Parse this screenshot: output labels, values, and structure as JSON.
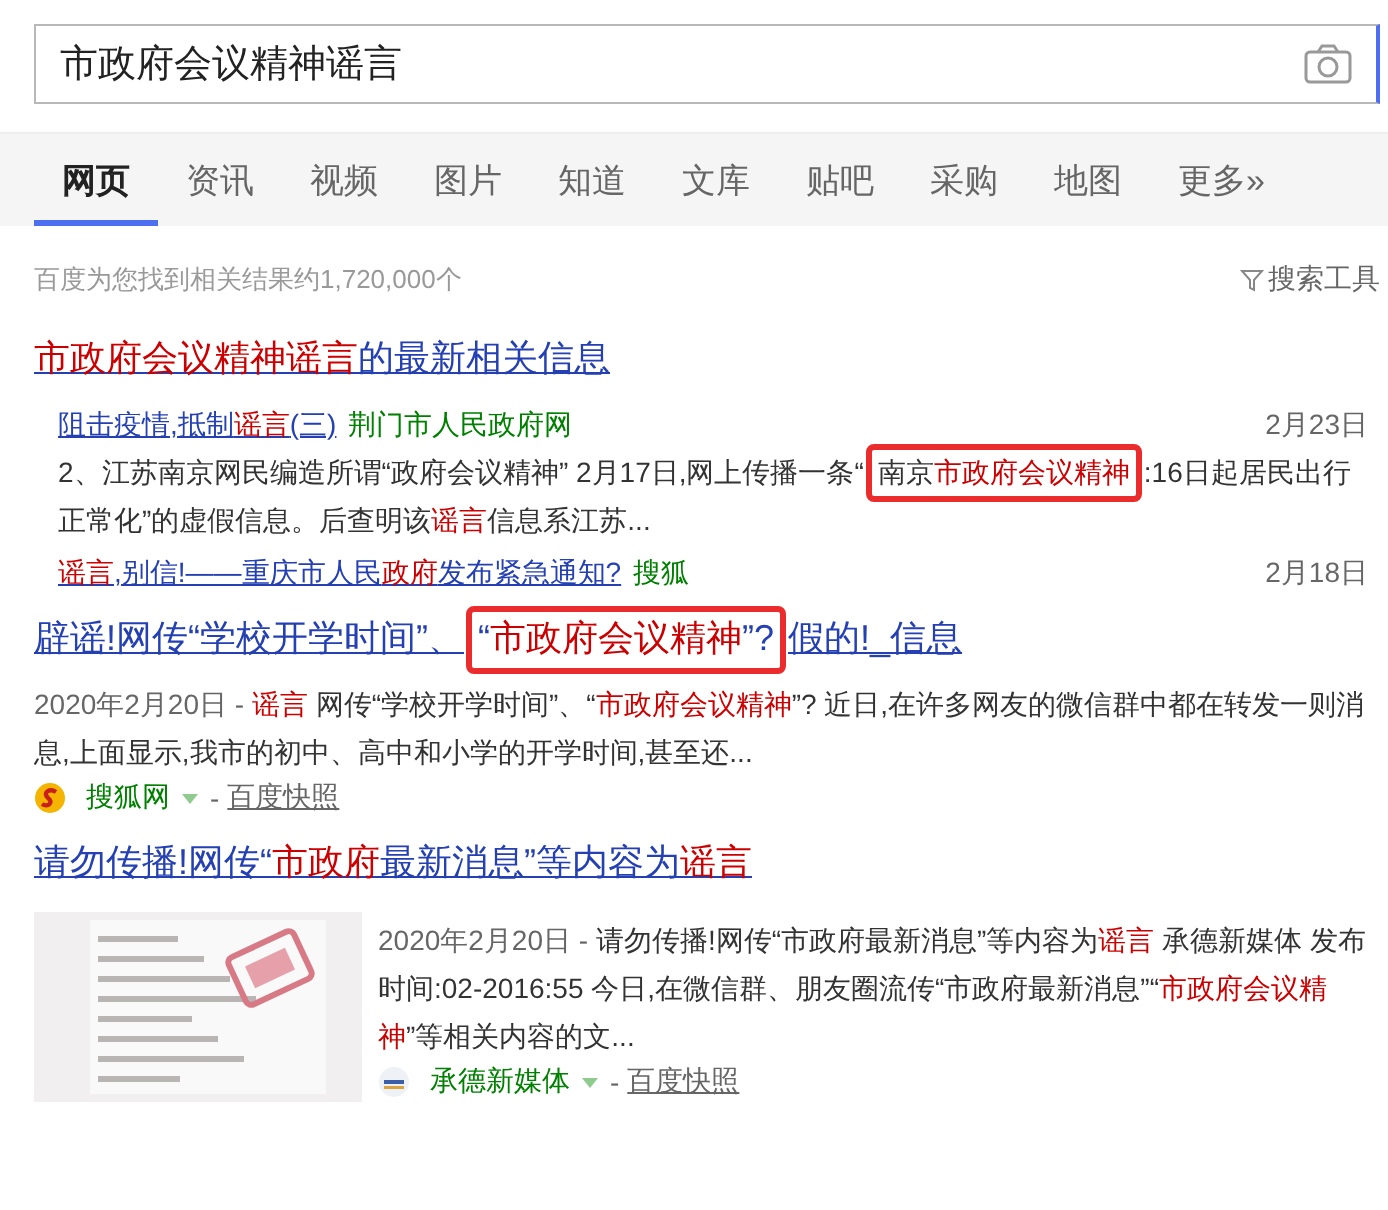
{
  "search": {
    "value": "市政府会议精神谣言"
  },
  "tabs": [
    {
      "label": "网页",
      "selected": true
    },
    {
      "label": "资讯",
      "selected": false
    },
    {
      "label": "视频",
      "selected": false
    },
    {
      "label": "图片",
      "selected": false
    },
    {
      "label": "知道",
      "selected": false
    },
    {
      "label": "文库",
      "selected": false
    },
    {
      "label": "贴吧",
      "selected": false
    },
    {
      "label": "采购",
      "selected": false
    },
    {
      "label": "地图",
      "selected": false
    },
    {
      "label": "更多»",
      "selected": false
    }
  ],
  "result_count": "百度为您找到相关结果约1,720,000个",
  "search_tools": "搜索工具",
  "news_block": {
    "title": [
      {
        "text": "市政府会议精神谣言",
        "em": true
      },
      {
        "text": "的最新相关信息",
        "em": false
      }
    ],
    "items": [
      {
        "kind": "news",
        "title": [
          {
            "text": "阻击疫情,抵制",
            "em": false
          },
          {
            "text": "谣言",
            "em": true
          },
          {
            "text": "(三)",
            "em": false
          }
        ],
        "source": "荆门市人民政府网",
        "date": "2月23日",
        "snippet": [
          {
            "text": "2、江苏南京网民编造所谓“政府会议精神” 2月17日,网上传播一条“",
            "em": false,
            "boxed": false
          },
          {
            "text": "南京",
            "em": false,
            "boxed": true
          },
          {
            "text": "市政府会议精神",
            "em": true,
            "boxed": true
          },
          {
            "text": ":16日起居民出行正常化”的虚假信息。后查明该",
            "em": false,
            "boxed": false
          },
          {
            "text": "谣言",
            "em": true,
            "boxed": false
          },
          {
            "text": "信息系江苏...",
            "em": false,
            "boxed": false
          }
        ]
      },
      {
        "kind": "news",
        "title": [
          {
            "text": "谣言",
            "em": true
          },
          {
            "text": ",别信!——重庆市人民",
            "em": false
          },
          {
            "text": "政府",
            "em": true
          },
          {
            "text": "发布紧急通知?",
            "em": false
          }
        ],
        "source": "搜狐",
        "date": "2月18日"
      }
    ]
  },
  "results": [
    {
      "title": [
        {
          "text": "辟谣!网传“学校开学时间”、",
          "em": false,
          "boxed": false
        },
        {
          "text": "“",
          "em": false,
          "boxed": true
        },
        {
          "text": "市政府会议精神",
          "em": true,
          "boxed": true
        },
        {
          "text": "”?",
          "em": false,
          "boxed": true
        },
        {
          "text": "假的!_信息",
          "em": false,
          "boxed": false
        }
      ],
      "snippet": [
        {
          "text": "2020年2月20日 - ",
          "em": false,
          "kind": "date"
        },
        {
          "text": "谣言",
          "em": true
        },
        {
          "text": " 网传“学校开学时间”、“",
          "em": false
        },
        {
          "text": "市政府会议精神",
          "em": true
        },
        {
          "text": "”? 近日,在许多网友的微信群中都在转发一则消息,上面显示,我市的初中、高中和小学的开学时间,甚至还...",
          "em": false
        }
      ],
      "source": "搜狐网",
      "separator": "-",
      "cache": "百度快照",
      "thumbnail": false
    },
    {
      "title": [
        {
          "text": "请勿传播!网传“",
          "em": false
        },
        {
          "text": "市政府",
          "em": true
        },
        {
          "text": "最新消息”等内容为",
          "em": false
        },
        {
          "text": "谣言",
          "em": true
        }
      ],
      "snippet": [
        {
          "text": "2020年2月20日 - ",
          "em": false,
          "kind": "date"
        },
        {
          "text": "请勿传播!网传“市政府最新消息”等内容为",
          "em": false
        },
        {
          "text": "谣言",
          "em": true
        },
        {
          "text": " 承德新媒体 发布时间:02-2016:55 今日,在微信群、朋友圈流传“市政府最新消息”“",
          "em": false
        },
        {
          "text": "市政府会议精神",
          "em": true
        },
        {
          "text": "”等相关内容的文...",
          "em": false
        }
      ],
      "source": "承德新媒体",
      "separator": "-",
      "cache": "百度快照",
      "thumbnail": true
    }
  ]
}
